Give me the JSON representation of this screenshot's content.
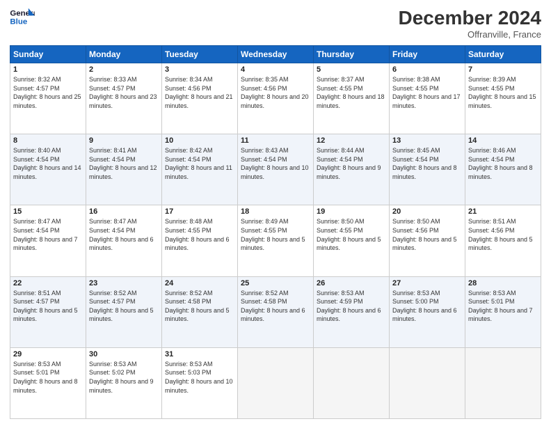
{
  "header": {
    "logo_line1": "General",
    "logo_line2": "Blue",
    "month": "December 2024",
    "location": "Offranville, France"
  },
  "days_of_week": [
    "Sunday",
    "Monday",
    "Tuesday",
    "Wednesday",
    "Thursday",
    "Friday",
    "Saturday"
  ],
  "weeks": [
    [
      {
        "day": "1",
        "sunrise": "8:32 AM",
        "sunset": "4:57 PM",
        "daylight": "8 hours and 25 minutes."
      },
      {
        "day": "2",
        "sunrise": "8:33 AM",
        "sunset": "4:57 PM",
        "daylight": "8 hours and 23 minutes."
      },
      {
        "day": "3",
        "sunrise": "8:34 AM",
        "sunset": "4:56 PM",
        "daylight": "8 hours and 21 minutes."
      },
      {
        "day": "4",
        "sunrise": "8:35 AM",
        "sunset": "4:56 PM",
        "daylight": "8 hours and 20 minutes."
      },
      {
        "day": "5",
        "sunrise": "8:37 AM",
        "sunset": "4:55 PM",
        "daylight": "8 hours and 18 minutes."
      },
      {
        "day": "6",
        "sunrise": "8:38 AM",
        "sunset": "4:55 PM",
        "daylight": "8 hours and 17 minutes."
      },
      {
        "day": "7",
        "sunrise": "8:39 AM",
        "sunset": "4:55 PM",
        "daylight": "8 hours and 15 minutes."
      }
    ],
    [
      {
        "day": "8",
        "sunrise": "8:40 AM",
        "sunset": "4:54 PM",
        "daylight": "8 hours and 14 minutes."
      },
      {
        "day": "9",
        "sunrise": "8:41 AM",
        "sunset": "4:54 PM",
        "daylight": "8 hours and 12 minutes."
      },
      {
        "day": "10",
        "sunrise": "8:42 AM",
        "sunset": "4:54 PM",
        "daylight": "8 hours and 11 minutes."
      },
      {
        "day": "11",
        "sunrise": "8:43 AM",
        "sunset": "4:54 PM",
        "daylight": "8 hours and 10 minutes."
      },
      {
        "day": "12",
        "sunrise": "8:44 AM",
        "sunset": "4:54 PM",
        "daylight": "8 hours and 9 minutes."
      },
      {
        "day": "13",
        "sunrise": "8:45 AM",
        "sunset": "4:54 PM",
        "daylight": "8 hours and 8 minutes."
      },
      {
        "day": "14",
        "sunrise": "8:46 AM",
        "sunset": "4:54 PM",
        "daylight": "8 hours and 8 minutes."
      }
    ],
    [
      {
        "day": "15",
        "sunrise": "8:47 AM",
        "sunset": "4:54 PM",
        "daylight": "8 hours and 7 minutes."
      },
      {
        "day": "16",
        "sunrise": "8:47 AM",
        "sunset": "4:54 PM",
        "daylight": "8 hours and 6 minutes."
      },
      {
        "day": "17",
        "sunrise": "8:48 AM",
        "sunset": "4:55 PM",
        "daylight": "8 hours and 6 minutes."
      },
      {
        "day": "18",
        "sunrise": "8:49 AM",
        "sunset": "4:55 PM",
        "daylight": "8 hours and 5 minutes."
      },
      {
        "day": "19",
        "sunrise": "8:50 AM",
        "sunset": "4:55 PM",
        "daylight": "8 hours and 5 minutes."
      },
      {
        "day": "20",
        "sunrise": "8:50 AM",
        "sunset": "4:56 PM",
        "daylight": "8 hours and 5 minutes."
      },
      {
        "day": "21",
        "sunrise": "8:51 AM",
        "sunset": "4:56 PM",
        "daylight": "8 hours and 5 minutes."
      }
    ],
    [
      {
        "day": "22",
        "sunrise": "8:51 AM",
        "sunset": "4:57 PM",
        "daylight": "8 hours and 5 minutes."
      },
      {
        "day": "23",
        "sunrise": "8:52 AM",
        "sunset": "4:57 PM",
        "daylight": "8 hours and 5 minutes."
      },
      {
        "day": "24",
        "sunrise": "8:52 AM",
        "sunset": "4:58 PM",
        "daylight": "8 hours and 5 minutes."
      },
      {
        "day": "25",
        "sunrise": "8:52 AM",
        "sunset": "4:58 PM",
        "daylight": "8 hours and 6 minutes."
      },
      {
        "day": "26",
        "sunrise": "8:53 AM",
        "sunset": "4:59 PM",
        "daylight": "8 hours and 6 minutes."
      },
      {
        "day": "27",
        "sunrise": "8:53 AM",
        "sunset": "5:00 PM",
        "daylight": "8 hours and 6 minutes."
      },
      {
        "day": "28",
        "sunrise": "8:53 AM",
        "sunset": "5:01 PM",
        "daylight": "8 hours and 7 minutes."
      }
    ],
    [
      {
        "day": "29",
        "sunrise": "8:53 AM",
        "sunset": "5:01 PM",
        "daylight": "8 hours and 8 minutes."
      },
      {
        "day": "30",
        "sunrise": "8:53 AM",
        "sunset": "5:02 PM",
        "daylight": "8 hours and 9 minutes."
      },
      {
        "day": "31",
        "sunrise": "8:53 AM",
        "sunset": "5:03 PM",
        "daylight": "8 hours and 10 minutes."
      },
      null,
      null,
      null,
      null
    ]
  ]
}
